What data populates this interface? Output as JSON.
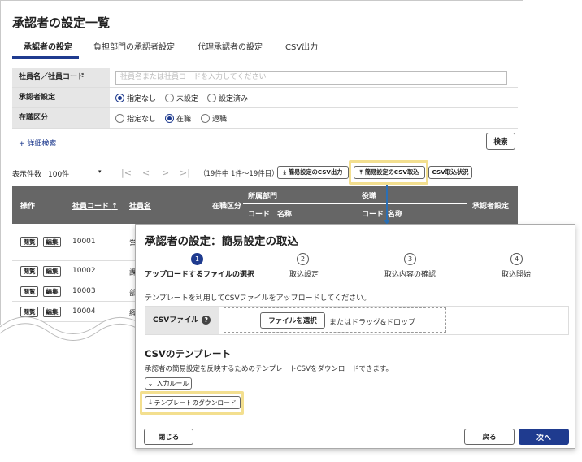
{
  "page": {
    "title": "承認者の設定一覧",
    "tabs": [
      "承認者の設定",
      "負担部門の承認者設定",
      "代理承認者の設定",
      "CSV出力"
    ]
  },
  "filters": {
    "employee": {
      "label": "社員名／社員コード",
      "placeholder": "社員名または社員コードを入力してください"
    },
    "approver": {
      "label": "承認者設定",
      "options": [
        "指定なし",
        "未設定",
        "設定済み"
      ],
      "selected": "指定なし"
    },
    "employment": {
      "label": "在職区分",
      "options": [
        "指定なし",
        "在職",
        "退職"
      ],
      "selected": "在職"
    },
    "detail_link": "+ 詳細検索",
    "search_button": "検索"
  },
  "list_toolbar": {
    "show_count_label": "表示件数",
    "show_count_value": "100件",
    "pager": {
      "first": "|<",
      "prev": "<",
      "next": ">",
      "last": ">|"
    },
    "count_text": "（19件中 1件～19件目）",
    "csv_output_button": "簡易設定のCSV出力",
    "csv_import_button": "簡易設定のCSV取込",
    "import_status_button": "CSV取込状況"
  },
  "table": {
    "headers": {
      "action": "操作",
      "code": "社員コード",
      "name": "社員名",
      "employment": "在職区分",
      "dept": "所属部門",
      "dept_code": "コード",
      "dept_name": "名称",
      "position": "役職",
      "pos_code": "コード",
      "pos_name": "名称",
      "approver": "承認者設定"
    },
    "row_buttons": {
      "view": "閲覧",
      "edit": "編集"
    },
    "rows": [
      {
        "code": "10001",
        "name": "営"
      },
      {
        "code": "10002",
        "name": "課"
      },
      {
        "code": "10003",
        "name": "部"
      },
      {
        "code": "10004",
        "name": "経"
      }
    ]
  },
  "modal": {
    "title": "承認者の設定：簡易設定の取込",
    "steps": [
      {
        "num": "1",
        "label": "アップロードするファイルの選択"
      },
      {
        "num": "2",
        "label": "取込設定"
      },
      {
        "num": "3",
        "label": "取込内容の確認"
      },
      {
        "num": "4",
        "label": "取込開始"
      }
    ],
    "description": "テンプレートを利用してCSVファイルをアップロードしてください。",
    "csv_label": "CSVファイル",
    "help_glyph": "?",
    "choose_file_button": "ファイルを選択",
    "drop_text": "またはドラッグ&ドロップ",
    "template_title": "CSVのテンプレート",
    "template_desc": "承認者の簡易設定を反映するためのテンプレートCSVをダウンロードできます。",
    "rules_button": "入力ルール",
    "download_button": "テンプレートのダウンロード",
    "close_button": "閉じる",
    "back_button": "戻る",
    "next_button": "次へ"
  },
  "colors": {
    "accent": "#1f3b8f",
    "highlight": "#f3df8f",
    "header_bg": "#666666"
  }
}
